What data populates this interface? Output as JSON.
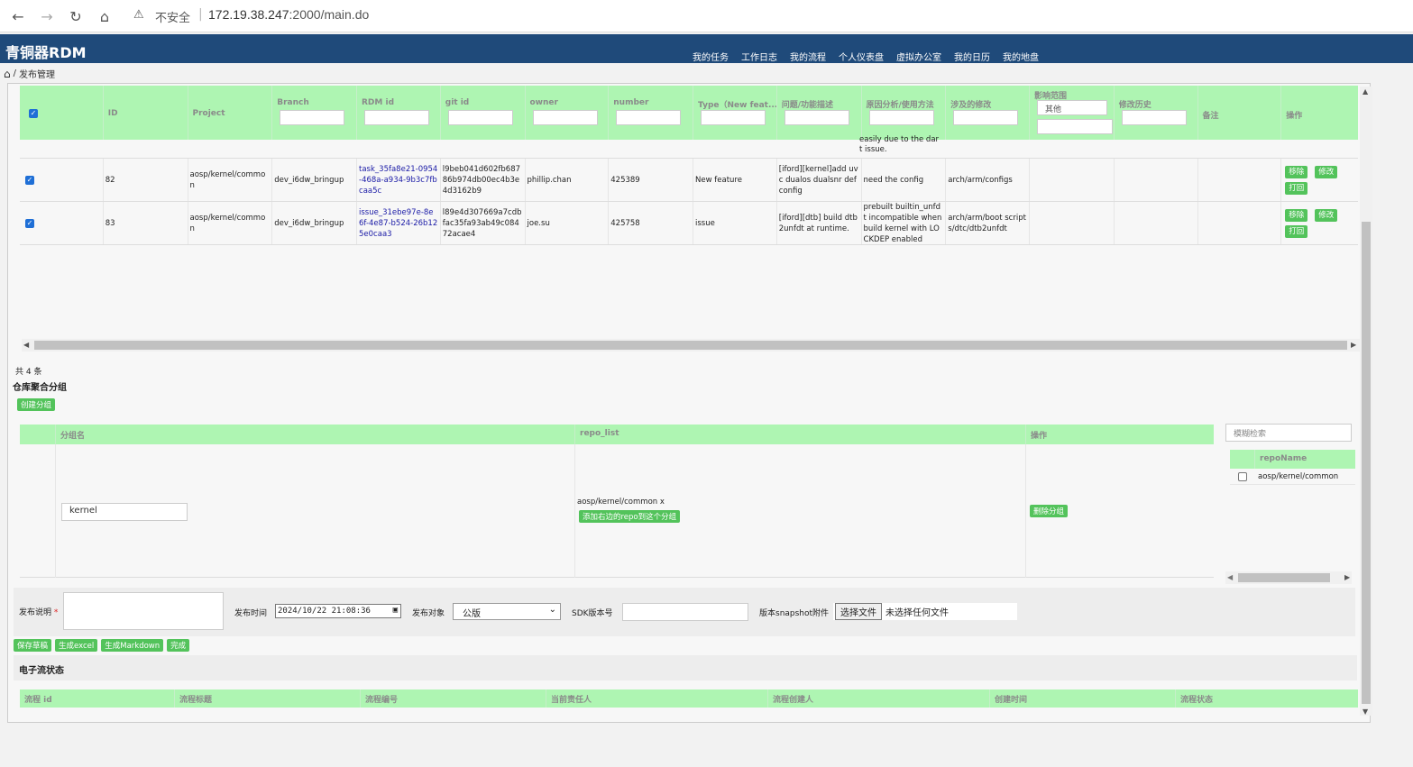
{
  "browser": {
    "security_label": "不安全",
    "url_host": "172.19.38.247",
    "url_rest": ":2000/main.do"
  },
  "app": {
    "title": "青铜器RDM",
    "nav": [
      "我的任务",
      "工作日志",
      "我的流程",
      "个人仪表盘",
      "虚拟办公室",
      "我的日历",
      "我的地盘"
    ]
  },
  "breadcrumb": {
    "separator": "/",
    "current": "发布管理"
  },
  "release_table": {
    "headers": [
      "ID",
      "Project",
      "Branch",
      "RDM id",
      "git id",
      "owner",
      "number",
      "Type（New feat...",
      "问题/功能描述",
      "原因分析/使用方法",
      "涉及的修改",
      "影响范围",
      "修改历史",
      "备注",
      "操作"
    ],
    "impact_filter_value": "其他",
    "partial_text": "easily due to the dar t issue.",
    "rows": [
      {
        "id": "82",
        "project": "aosp/kernel/common",
        "branch": "dev_i6dw_bringup",
        "rdm_id": "task_35fa8e21-0954-468a-a934-9b3c7fbcaa5c",
        "git_id": "l9beb041d602fb68786b974db00ec4b3e4d3162b9",
        "owner": "phillip.chan",
        "number": "425389",
        "type": "New feature",
        "desc": "[iford][kernel]add uvc dualos dualsnr def config",
        "reason": "need the config",
        "changes": "arch/arm/configs",
        "impact": "",
        "history": "",
        "note": "",
        "actions": [
          "移除",
          "修改",
          "打回"
        ]
      },
      {
        "id": "83",
        "project": "aosp/kernel/common",
        "branch": "dev_i6dw_bringup",
        "rdm_id": "issue_31ebe97e-8e6f-4e87-b524-26b125e0caa3",
        "git_id": "l89e4d307669a7cdbfac35fa93ab49c08472acae4",
        "owner": "joe.su",
        "number": "425758",
        "type": "issue",
        "desc": "[iford][dtb] build dtb2unfdt at runtime.",
        "reason": "prebuilt builtin_unfdt incompatible when build kernel with LOCKDEP enabled",
        "changes": "arch/arm/boot scripts/dtc/dtb2unfdt",
        "impact": "",
        "history": "",
        "note": "",
        "actions": [
          "移除",
          "修改",
          "打回"
        ]
      }
    ],
    "total_label": "共 4 条"
  },
  "repo_group": {
    "section_title": "仓库聚合分组",
    "create_button": "创建分组",
    "headers": [
      "分组名",
      "repo_list",
      "操作"
    ],
    "row": {
      "group_name": "kernel",
      "repo_item": "aosp/kernel/common x",
      "add_button": "添加右边的repo到这个分组",
      "delete_button": "删除分组"
    },
    "search_placeholder": "模糊检索",
    "repo_header": "repoName",
    "repo_items": [
      "aosp/kernel/common"
    ]
  },
  "release_form": {
    "desc_label": "发布说明",
    "required_mark": "*",
    "time_label": "发布时间",
    "time_value": "2024/10/22  21:08:36",
    "target_label": "发布对象",
    "target_value": "公版",
    "sdk_label": "SDK版本号",
    "snapshot_label": "版本snapshot附件",
    "choose_file": "选择文件",
    "no_file": "未选择任何文件",
    "buttons": [
      "保存草稿",
      "生成excel",
      "生成Markdown",
      "完成"
    ]
  },
  "flow": {
    "title": "电子流状态",
    "headers": [
      "流程 id",
      "流程标题",
      "流程编号",
      "当前责任人",
      "流程创建人",
      "创建时间",
      "流程状态"
    ]
  },
  "colors": {
    "header_blue": "#1f4a7a",
    "table_header_green": "#aef5b2",
    "button_green": "#53c35b",
    "link_blue": "#1a1aa6"
  }
}
